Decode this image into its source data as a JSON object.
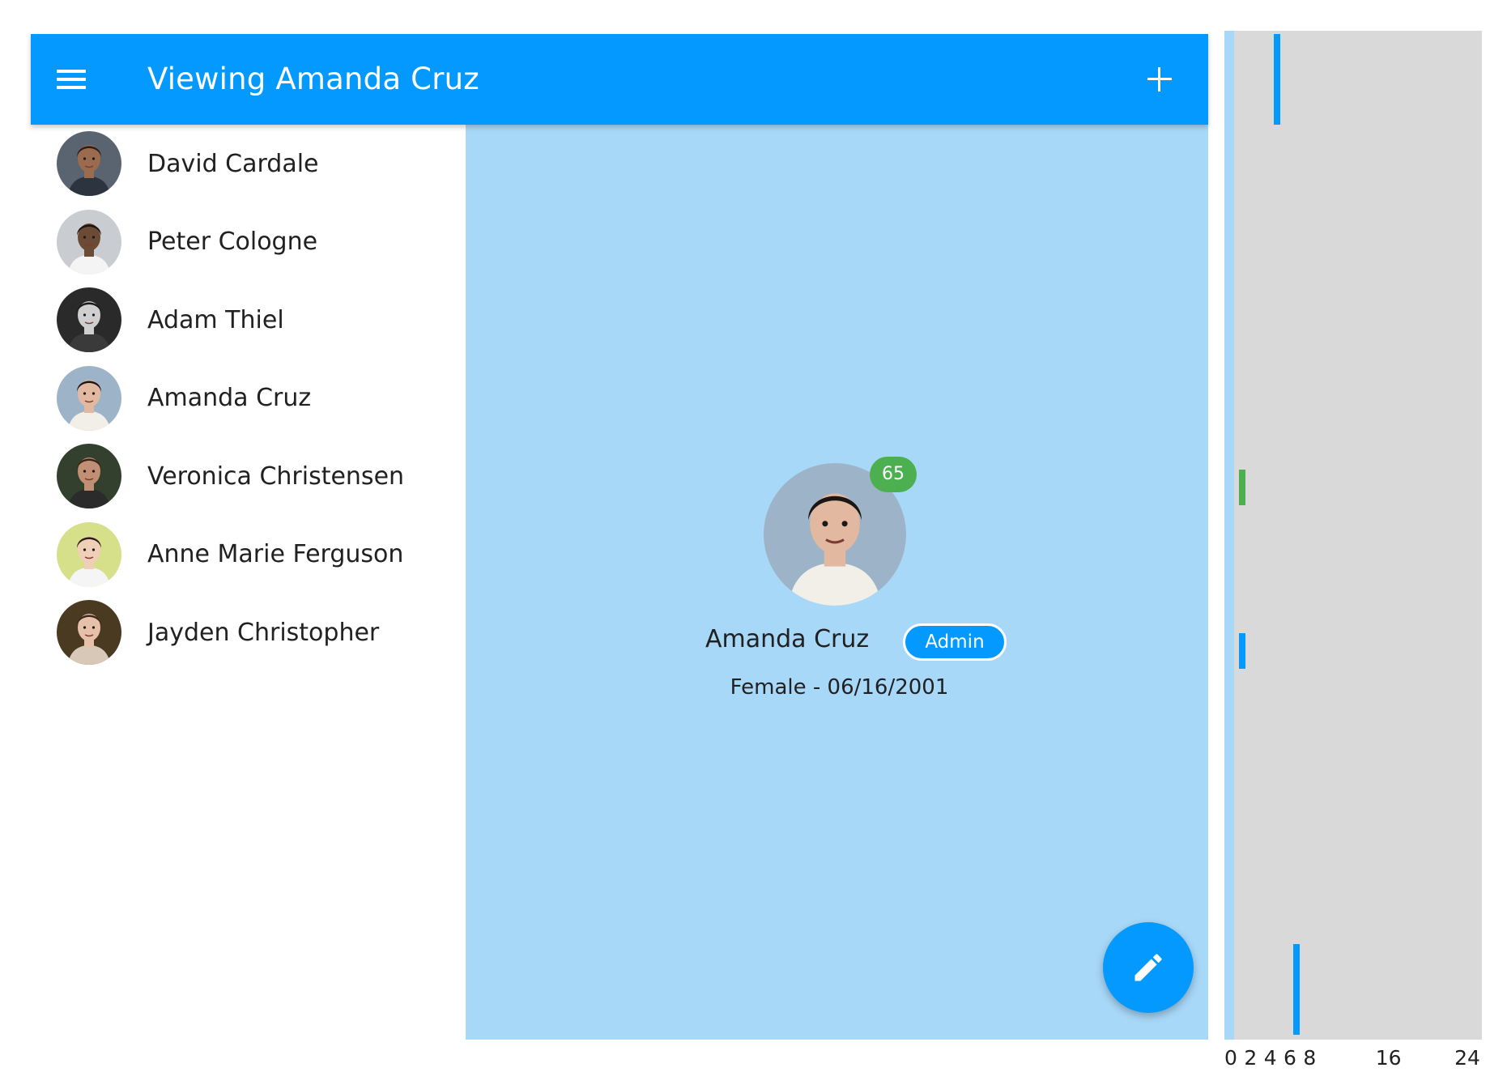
{
  "app_bar": {
    "title": "Viewing Amanda Cruz",
    "menu_icon": "menu-icon",
    "add_icon": "add-icon",
    "color": "#0399ff"
  },
  "users": [
    {
      "name": "David Cardale",
      "avatar_colors": {
        "bg": "#5a6470",
        "skin": "#9a6b4f",
        "hair": "#2a1e18",
        "shirt": "#2c3440"
      }
    },
    {
      "name": "Peter Cologne",
      "avatar_colors": {
        "bg": "#c9ccd0",
        "skin": "#6b4a36",
        "hair": "#1c1410",
        "shirt": "#f4f4f4"
      }
    },
    {
      "name": "Adam Thiel",
      "avatar_colors": {
        "bg": "#2a2a2a",
        "skin": "#cfcfcf",
        "hair": "#1a1a1a",
        "shirt": "#3a3a3a"
      }
    },
    {
      "name": "Amanda Cruz",
      "avatar_colors": {
        "bg": "#9db4c8",
        "skin": "#e2b9a0",
        "hair": "#1b1614",
        "shirt": "#f2efe9"
      }
    },
    {
      "name": "Veronica Christensen",
      "avatar_colors": {
        "bg": "#34402e",
        "skin": "#c08f74",
        "hair": "#3a2418",
        "shirt": "#2b2b2b"
      }
    },
    {
      "name": "Anne Marie Ferguson",
      "avatar_colors": {
        "bg": "#d6e08a",
        "skin": "#f0cfb8",
        "hair": "#2b1d14",
        "shirt": "#f5f5f5"
      }
    },
    {
      "name": "Jayden Christopher",
      "avatar_colors": {
        "bg": "#4a3a22",
        "skin": "#e6c0a8",
        "hair": "#3b2a1c",
        "shirt": "#d8c8b8"
      }
    }
  ],
  "selected_user": {
    "name": "Amanda Cruz",
    "age": "65",
    "role": "Admin",
    "details": "Female - 06/16/2001",
    "edit_icon": "edit-icon",
    "age_badge_color": "#4caf50"
  },
  "timeline": {
    "axis_ticks": [
      "0",
      "2",
      "4",
      "6",
      "8",
      "16",
      "24"
    ],
    "axis_values": [
      0,
      2,
      4,
      6,
      8,
      16,
      24
    ],
    "axis_max": 24,
    "marks": [
      {
        "value": 4.0,
        "row": "app-bar",
        "color": "#0399ff"
      },
      {
        "value": 0.5,
        "row": "age-badge",
        "color": "#4caf50"
      },
      {
        "value": 0.5,
        "row": "profile-name",
        "color": "#0399ff"
      },
      {
        "value": 6.0,
        "row": "fab",
        "color": "#0399ff"
      }
    ]
  }
}
